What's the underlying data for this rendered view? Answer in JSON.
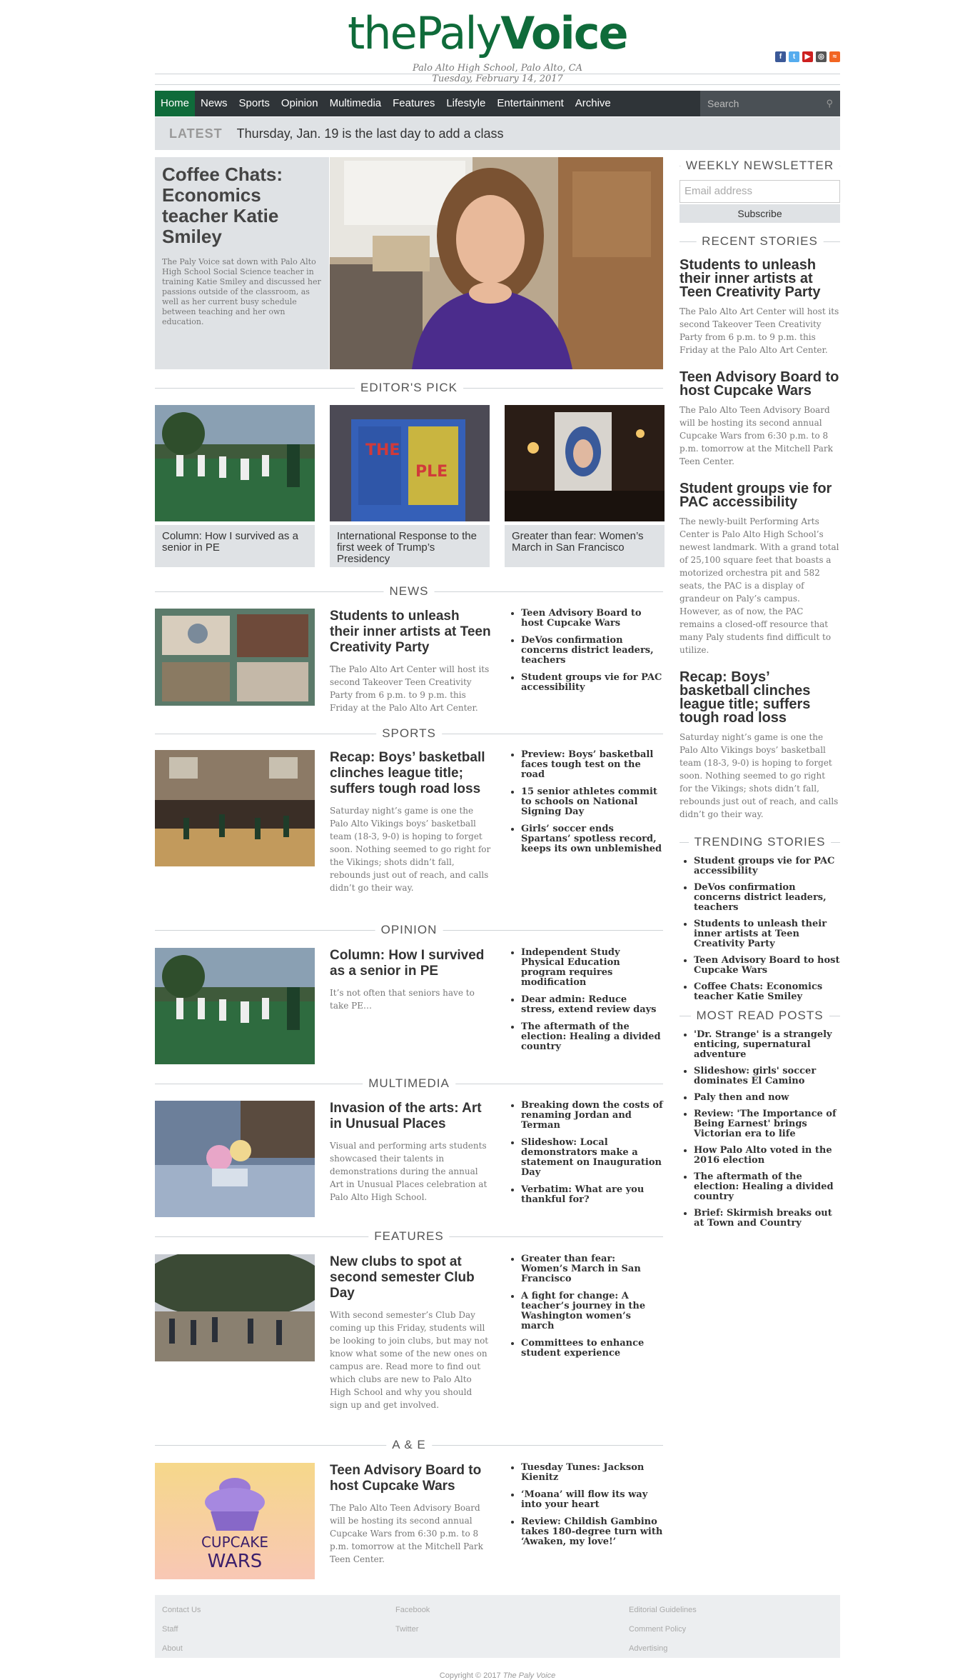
{
  "masthead": {
    "logo_the": "the",
    "logo_paly": "Paly",
    "logo_voice": "Voice",
    "school": "Palo Alto High School, Palo Alto, CA",
    "date": "Tuesday, February 14, 2017",
    "social": [
      {
        "icon": "facebook-icon",
        "color": "#3b5998",
        "glyph": "f"
      },
      {
        "icon": "twitter-icon",
        "color": "#55acee",
        "glyph": "t"
      },
      {
        "icon": "youtube-icon",
        "color": "#cd201f",
        "glyph": "▶"
      },
      {
        "icon": "instagram-icon",
        "color": "#555555",
        "glyph": "◎"
      },
      {
        "icon": "rss-icon",
        "color": "#f26522",
        "glyph": "≈"
      }
    ]
  },
  "nav": {
    "items": [
      "Home",
      "News",
      "Sports",
      "Opinion",
      "Multimedia",
      "Features",
      "Lifestyle",
      "Entertainment",
      "Archive"
    ],
    "search_placeholder": "Search"
  },
  "latest": {
    "label": "LATEST",
    "text": "Thursday, Jan. 19 is the last day to add a class"
  },
  "feature": {
    "title": "Coffee Chats: Economics teacher Katie Smiley",
    "summary": "The Paly Voice sat down with Palo Alto High School Social Science teacher in training Katie Smiley and discussed her passions outside of the classroom, as well as her current busy schedule between teaching and her own education."
  },
  "editors_pick": {
    "heading": "EDITOR'S PICK",
    "items": [
      {
        "caption": "Column: How I survived as a senior in PE"
      },
      {
        "caption": "International Response to the first week of Trump’s Presidency"
      },
      {
        "caption": "Greater than fear: Women’s March in San Francisco"
      }
    ]
  },
  "sections": [
    {
      "heading": "NEWS",
      "title": "Students to unleash their inner artists at Teen Creativity Party",
      "summary": "The Palo Alto Art Center will host its second Takeover Teen Creativity Party from 6 p.m. to 9 p.m. this Friday at the Palo Alto Art Center.",
      "links": [
        "Teen Advisory Board to host Cupcake Wars",
        "DeVos confirmation concerns district leaders, teachers",
        "Student groups vie for PAC accessibility"
      ]
    },
    {
      "heading": "SPORTS",
      "title": "Recap: Boys’ basketball clinches league title; suffers tough road loss",
      "summary": "Saturday night’s game is one the Palo Alto Vikings boys’ basketball team (18-3, 9-0) is hoping to forget soon. Nothing seemed to go right for the Vikings; shots didn’t fall, rebounds just out of reach, and calls didn’t go their way.",
      "links": [
        "Preview: Boys’ basketball faces tough test on the road",
        "15 senior athletes commit to schools on National Signing Day",
        "Girls’ soccer ends Spartans’ spotless record, keeps its own unblemished"
      ]
    },
    {
      "heading": "OPINION",
      "title": "Column: How I survived as a senior in PE",
      "summary": "It’s not often that seniors have to take PE…",
      "links": [
        "Independent Study Physical Education program requires modification",
        "Dear admin: Reduce stress, extend review days",
        "The aftermath of the election: Healing a divided country"
      ]
    },
    {
      "heading": "MULTIMEDIA",
      "title": "Invasion of the arts: Art in Unusual Places",
      "summary": "Visual and performing arts students showcased their talents in demonstrations during the annual Art in Unusual Places celebration at Palo Alto High School.",
      "links": [
        "Breaking down the costs of renaming Jordan and Terman",
        "Slideshow: Local demonstrators make a statement on Inauguration Day",
        "Verbatim: What are you thankful for?"
      ]
    },
    {
      "heading": "FEATURES",
      "title": "New clubs to spot at second semester Club Day",
      "summary": "With second semester’s Club Day coming up this Friday, students will be looking to join clubs, but may not know what some of the new ones on campus are. Read more to find out which clubs are new to Palo Alto High School and why you should sign up and get involved.",
      "links": [
        "Greater than fear: Women’s March in San Francisco",
        "A fight for change: A teacher’s journey in the Washington women’s march",
        "Committees to enhance student experience"
      ]
    },
    {
      "heading": "A & E",
      "title": "Teen Advisory Board to host Cupcake Wars",
      "summary": "The Palo Alto Teen Advisory Board will be hosting its second annual Cupcake Wars from 6:30 p.m. to 8 p.m. tomorrow at the Mitchell Park Teen Center.",
      "links": [
        "Tuesday Tunes: Jackson Kienitz",
        "‘Moana’ will flow its way into your heart",
        "Review: Childish Gambino takes 180-degree turn with ‘Awaken, my love!’"
      ]
    }
  ],
  "cupcake_art": {
    "line1": "CUPCAKE",
    "line2": "WARS"
  },
  "sidebar": {
    "newsletter_heading": "WEEKLY NEWSLETTER",
    "email_placeholder": "Email address",
    "subscribe_label": "Subscribe",
    "recent_heading": "RECENT STORIES",
    "recent": [
      {
        "title": "Students to unleash their inner artists at Teen Creativity Party",
        "summary": "The Palo Alto Art Center will host its second Takeover Teen Creativity Party from 6 p.m. to 9 p.m. this Friday at the Palo Alto Art Center."
      },
      {
        "title": "Teen Advisory Board to host Cupcake Wars",
        "summary": "The Palo Alto Teen Advisory Board will be hosting its second annual Cupcake Wars from 6:30 p.m. to 8 p.m. tomorrow at the Mitchell Park Teen Center."
      },
      {
        "title": "Student groups vie for PAC accessibility",
        "summary": "The newly-built Performing Arts Center is Palo Alto High School’s newest landmark. With a grand total of 25,100 square feet that boasts a motorized orchestra pit and 582 seats, the PAC is a display of grandeur on Paly’s campus. However, as of now, the PAC remains a closed-off resource that many Paly students find difficult to utilize."
      },
      {
        "title": "Recap: Boys’ basketball clinches league title; suffers tough road loss",
        "summary": "Saturday night’s game is one the Palo Alto Vikings boys’ basketball team (18-3, 9-0) is hoping to forget soon. Nothing seemed to go right for the Vikings; shots didn’t fall, rebounds just out of reach, and calls didn’t go their way."
      }
    ],
    "trending_heading": "TRENDING STORIES",
    "trending": [
      "Student groups vie for PAC accessibility",
      "DeVos confirmation concerns district leaders, teachers",
      "Students to unleash their inner artists at Teen Creativity Party",
      "Teen Advisory Board to host Cupcake Wars",
      "Coffee Chats: Economics teacher Katie Smiley"
    ],
    "mostread_heading": "MOST READ POSTS",
    "mostread": [
      "'Dr. Strange' is a strangely enticing, supernatural adventure",
      "Slideshow: girls' soccer dominates El Camino",
      "Paly then and now",
      "Review: 'The Importance of Being Earnest' brings Victorian era to life",
      "How Palo Alto voted in the 2016 election",
      "The aftermath of the election: Healing a divided country",
      "Brief: Skirmish breaks out at Town and Country"
    ]
  },
  "footer": {
    "col1": [
      "Contact Us",
      "Staff",
      "About"
    ],
    "col2": [
      "Facebook",
      "Twitter"
    ],
    "col3": [
      "Editorial Guidelines",
      "Comment Policy",
      "Advertising"
    ],
    "copyright_prefix": "Copyright © 2017 ",
    "copyright_name": "The Paly Voice"
  }
}
